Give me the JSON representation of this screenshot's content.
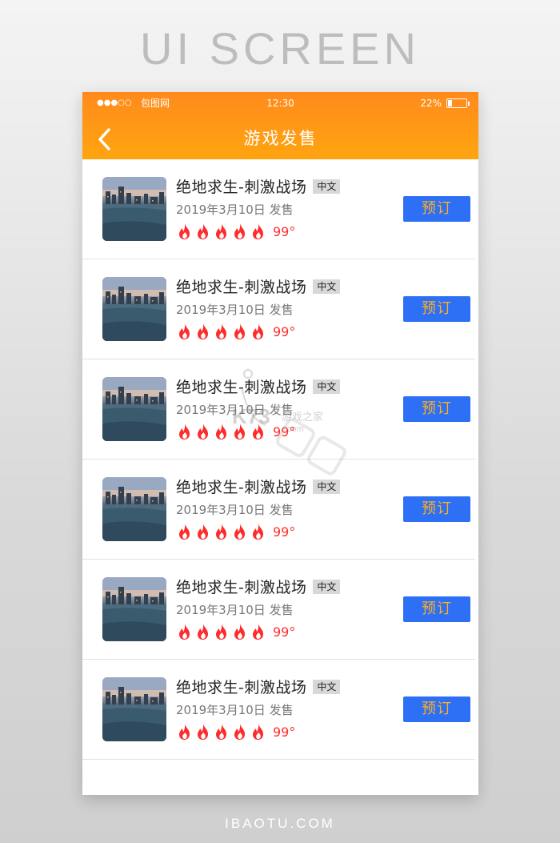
{
  "poster": {
    "heading": "UI SCREEN",
    "footer": "IBAOTU.COM"
  },
  "status_bar": {
    "signal": "●●●○○",
    "carrier": "包图网",
    "time": "12:30",
    "battery_percent": "22%",
    "battery_level": 0.22
  },
  "nav": {
    "back_icon": "chevron-left-icon",
    "title": "游戏发售"
  },
  "colors": {
    "header_top": "#ff8a1c",
    "header_bottom": "#ffa510",
    "button_bg": "#2d6ff5",
    "button_text": "#ffb01a",
    "flame": "#ff2b2b"
  },
  "games": [
    {
      "title": "绝地求生-刺激战场",
      "lang": "中文",
      "release": "2019年3月10日 发售",
      "heat": "99°",
      "flames": 5,
      "button": "预订"
    },
    {
      "title": "绝地求生-刺激战场",
      "lang": "中文",
      "release": "2019年3月10日 发售",
      "heat": "99°",
      "flames": 5,
      "button": "预订"
    },
    {
      "title": "绝地求生-刺激战场",
      "lang": "中文",
      "release": "2019年3月10日 发售",
      "heat": "99°",
      "flames": 5,
      "button": "预订"
    },
    {
      "title": "绝地求生-刺激战场",
      "lang": "中文",
      "release": "2019年3月10日 发售",
      "heat": "99°",
      "flames": 5,
      "button": "预订"
    },
    {
      "title": "绝地求生-刺激战场",
      "lang": "中文",
      "release": "2019年3月10日 发售",
      "heat": "99°",
      "flames": 5,
      "button": "预订"
    },
    {
      "title": "绝地求生-刺激战场",
      "lang": "中文",
      "release": "2019年3月10日 发售",
      "heat": "99°",
      "flames": 5,
      "button": "预订"
    }
  ],
  "watermark": {
    "brand": "K73",
    "tagline": "游戏之家",
    "domain": ".com"
  }
}
